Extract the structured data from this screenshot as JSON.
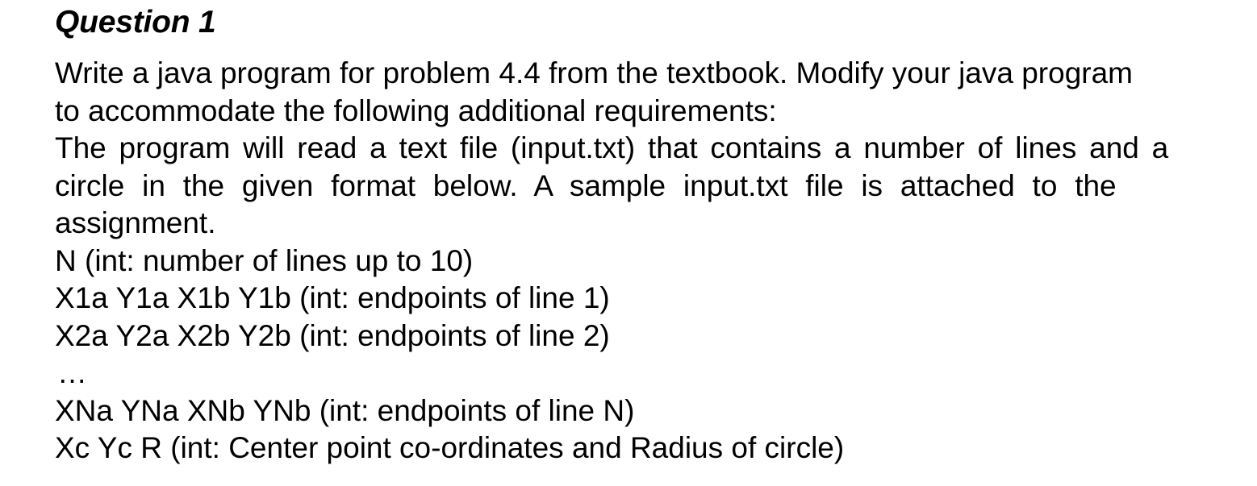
{
  "page": {
    "background_color": "#ffffff",
    "text_color": "#000000"
  },
  "document": {
    "title": "Question 1",
    "paragraphs": {
      "intro_line_1": "Write a java program for problem 4.4 from the textbook. Modify your java program",
      "intro_line_2": "to accommodate the following additional requirements:",
      "format_line_1": "The program will read a text file (input.txt) that contains a number of lines and a",
      "format_line_2": "circle in the given format below. A sample input.txt file is attached to the",
      "format_line_3": "assignment."
    },
    "input_format_spec": [
      "N (int: number of lines up to 10)",
      "X1a Y1a X1b Y1b (int: endpoints of line 1)",
      "X2a Y2a X2b Y2b (int: endpoints of line 2)"
    ],
    "ellipsis": "…",
    "input_format_spec_tail": [
      "XNa YNa XNb YNb (int: endpoints of line N)",
      "Xc Yc R (int: Center point co-ordinates and Radius of circle)"
    ]
  }
}
